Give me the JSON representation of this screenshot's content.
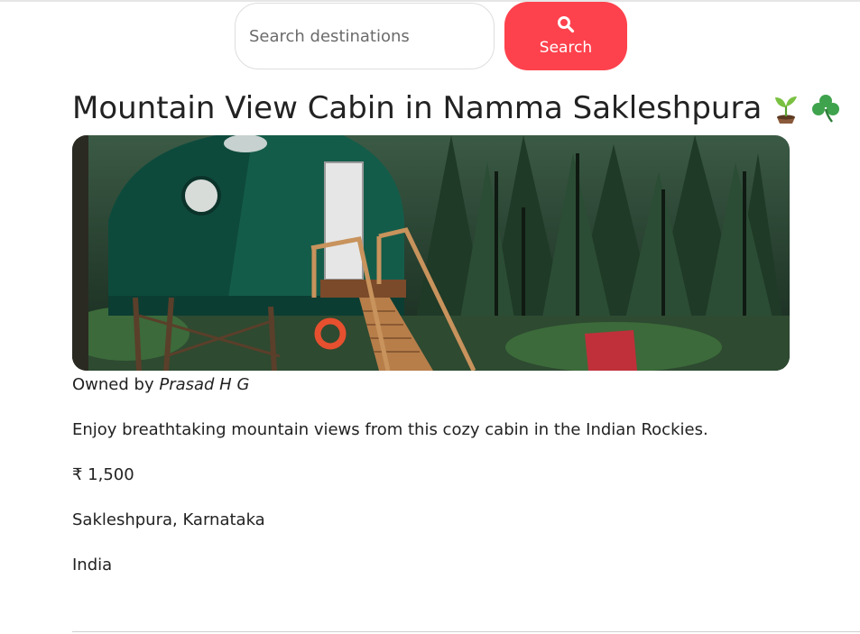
{
  "search": {
    "placeholder": "Search destinations",
    "button_label": "Search",
    "icon": "magnifying-glass-icon",
    "accent_color": "#fe424d"
  },
  "listing": {
    "title": "Mountain View Cabin in Namma Sakleshpura",
    "title_emojis": [
      "seedling-emoji",
      "shamrock-emoji"
    ],
    "owner_prefix": "Owned by",
    "owner_name": "Prasad H G",
    "description": "Enjoy breathtaking mountain views from this cozy cabin in the Indian Rockies.",
    "price": "₹ 1,500",
    "location": "Sakleshpura, Karnataka",
    "country": "India"
  }
}
